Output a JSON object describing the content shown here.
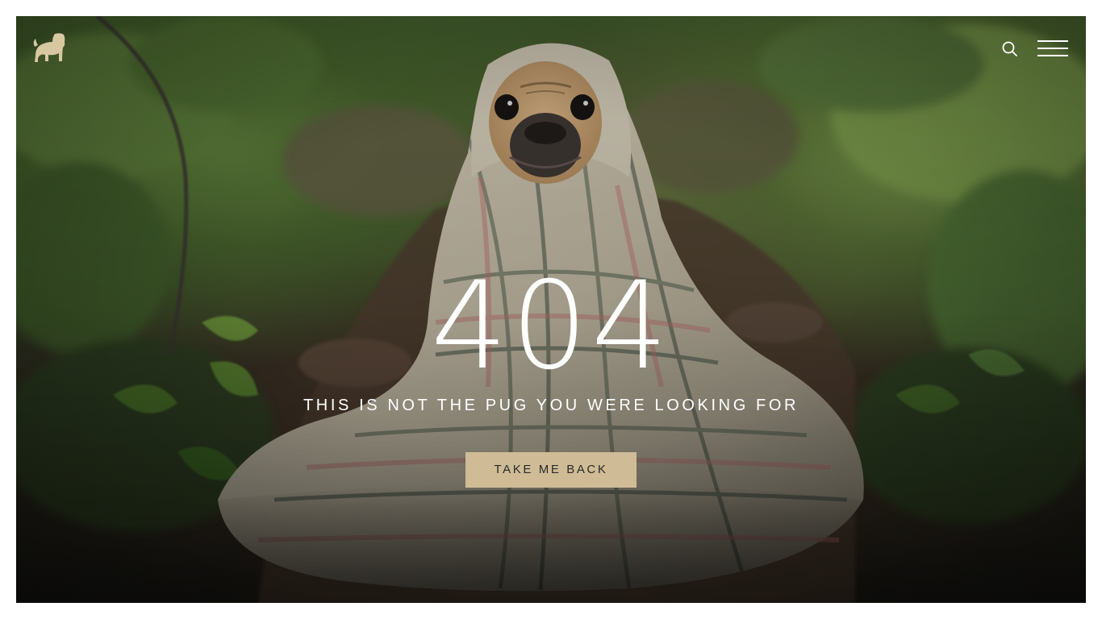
{
  "header": {
    "logo_icon": "pug-logo-icon",
    "search_icon": "search-icon",
    "menu_icon": "hamburger-menu-icon"
  },
  "error": {
    "code": "404",
    "message": "THIS IS NOT THE PUG YOU WERE LOOKING FOR",
    "button_label": "TAKE ME BACK"
  },
  "colors": {
    "accent": "#cfbc96",
    "logo": "#d8c8a2",
    "text": "#ffffff"
  }
}
